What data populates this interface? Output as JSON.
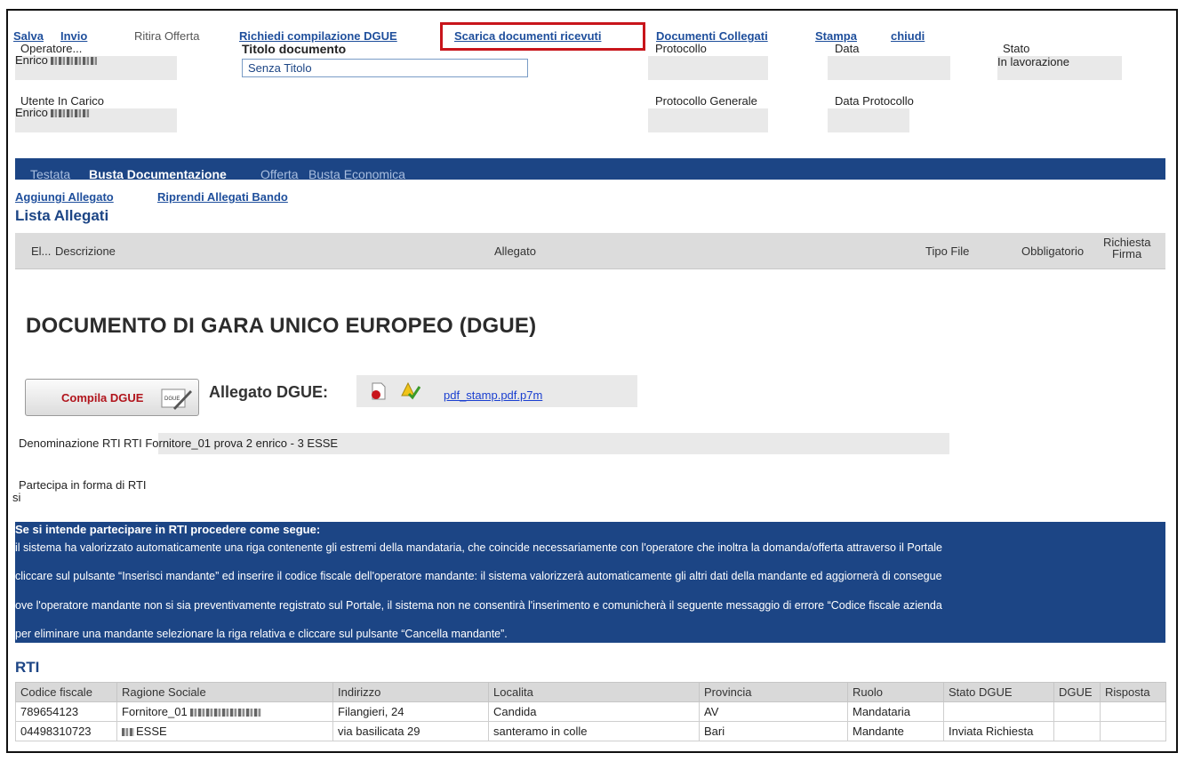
{
  "toolbar": {
    "salva": "Salva",
    "invio": "Invio",
    "ritira": "Ritira Offerta",
    "richiedi": "Richiedi compilazione DGUE",
    "scarica": "Scarica documenti ricevuti",
    "documenti": "Documenti Collegati",
    "stampa": "Stampa",
    "chiudi": "chiudi"
  },
  "header": {
    "operatore_label": "Operatore...",
    "operatore_value": "Enrico",
    "titolo_label": "Titolo documento",
    "titolo_value": "Senza Titolo",
    "protocollo_label": "Protocollo",
    "data_label": "Data",
    "stato_label": "Stato",
    "stato_value": "In lavorazione",
    "utente_label": "Utente In Carico",
    "utente_value": "Enrico",
    "protgen_label": "Protocollo Generale",
    "dataprot_label": "Data Protocollo"
  },
  "tabs": [
    "Testata",
    "Busta Documentazione",
    "Offerta",
    "Busta Economica"
  ],
  "actions": {
    "aggiungi": "Aggiungi Allegato",
    "riprendi": "Riprendi Allegati Bando"
  },
  "lista": {
    "title": "Lista Allegati",
    "columns": [
      "El...",
      "Descrizione",
      "Allegato",
      "Tipo File",
      "Obbligatorio",
      "Richiesta",
      "Firma"
    ]
  },
  "dgue": {
    "title": "DOCUMENTO DI GARA UNICO EUROPEO (DGUE)",
    "button": "Compila DGUE",
    "button_icon_text": "DGUE",
    "allegato_label": "Allegato DGUE:",
    "file": "pdf_stamp.pdf.p7m"
  },
  "rti_fields": {
    "denominazione_label": "Denominazione RTI",
    "denominazione_value": "RTI Fornitore_01 prova 2 enrico - 3 ESSE",
    "partecipa_label": "Partecipa in forma di RTI",
    "partecipa_value": "si"
  },
  "info": {
    "title": "Se si intende partecipare in RTI procedere come segue:",
    "lines": [
      "il sistema ha valorizzato automaticamente una riga contenente gli estremi della mandataria, che coincide necessariamente con l'operatore che inoltra la domanda/offerta attraverso il Portale",
      "cliccare sul pulsante “Inserisci mandante” ed inserire il codice fiscale dell'operatore mandante: il sistema valorizzerà automaticamente gli altri dati della mandante ed aggiornerà di consegue",
      "ove l'operatore mandante non si sia preventivamente registrato sul Portale, il sistema non ne consentirà l'inserimento e comunicherà il seguente messaggio di errore “Codice fiscale azienda",
      "per eliminare una mandante selezionare la riga relativa e cliccare sul pulsante “Cancella mandante”."
    ]
  },
  "rti": {
    "title": "RTI",
    "columns": [
      "Codice fiscale",
      "Ragione Sociale",
      "Indirizzo",
      "Localita",
      "Provincia",
      "Ruolo",
      "Stato DGUE",
      "DGUE",
      "Risposta"
    ],
    "rows": [
      [
        "789654123",
        "Fornitore_01",
        "Filangieri, 24",
        "Candida",
        "AV",
        "Mandataria",
        "",
        "",
        ""
      ],
      [
        "04498310723",
        "ESSE",
        "via basilicata 29",
        "santeramo in colle",
        "Bari",
        "Mandante",
        "Inviata Richiesta",
        "",
        ""
      ]
    ]
  },
  "colors": {
    "navy": "#1c4585",
    "link": "#1f4f9c",
    "highlight": "#c8151b"
  }
}
